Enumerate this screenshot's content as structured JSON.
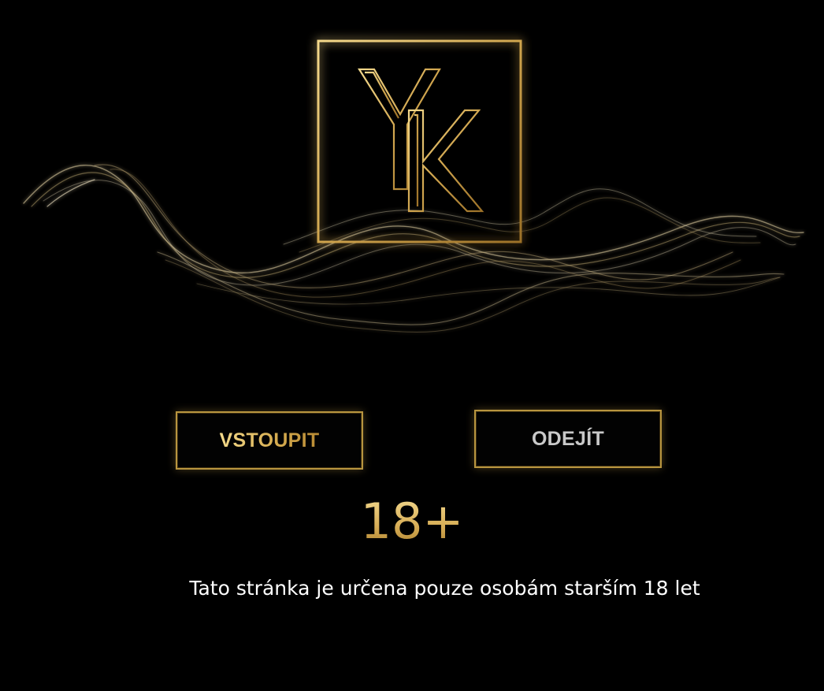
{
  "logo": {
    "letters": "YK",
    "accent_color": "#d4af63"
  },
  "buttons": {
    "enter_label": "VSTOUPIT",
    "leave_label": "ODEJÍT"
  },
  "age_badge": "18+",
  "notice": "Tato stránka je určena pouze osobám starším 18 let",
  "colors": {
    "background": "#000000",
    "gold": "#d4af63",
    "light_gold": "#f3d98a",
    "silver": "#c9c9c9"
  }
}
